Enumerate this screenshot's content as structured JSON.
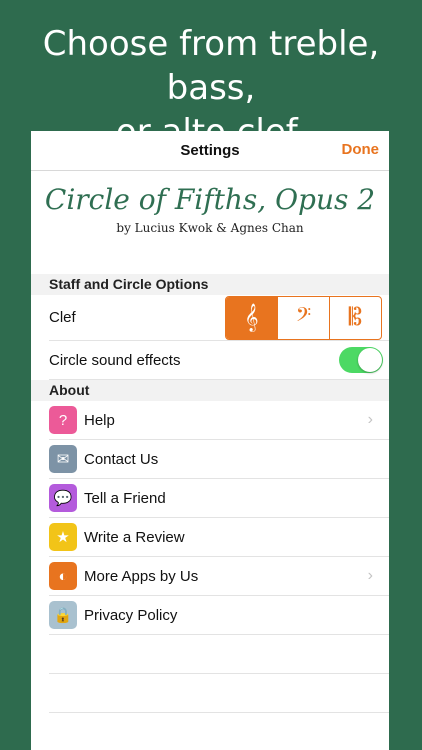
{
  "promo": {
    "line1": "Choose from treble, bass,",
    "line2": "or alto clef."
  },
  "nav": {
    "title": "Settings",
    "done": "Done"
  },
  "app": {
    "title": "Circle of Fifths, Opus 2",
    "byline": "by Lucius Kwok & Agnes Chan"
  },
  "staff_section": {
    "header": "Staff and Circle Options",
    "clef_label": "Clef",
    "clef_options": [
      {
        "icon": "treble-clef-icon",
        "glyph": "𝄞",
        "selected": true
      },
      {
        "icon": "bass-clef-icon",
        "glyph": "𝄢",
        "selected": false
      },
      {
        "icon": "alto-clef-icon",
        "glyph": "𝄡",
        "selected": false
      }
    ],
    "sound_label": "Circle sound effects",
    "sound_on": true
  },
  "about_section": {
    "header": "About",
    "items": [
      {
        "label": "Help",
        "icon": "help-icon",
        "glyph": "?",
        "color": "#ec5a98",
        "chevron": true
      },
      {
        "label": "Contact Us",
        "icon": "envelope-icon",
        "glyph": "✉",
        "color": "#7d93a6",
        "chevron": false
      },
      {
        "label": "Tell a Friend",
        "icon": "chat-bubble-icon",
        "glyph": "💬",
        "color": "#b45bdc",
        "chevron": false
      },
      {
        "label": "Write a Review",
        "icon": "star-icon",
        "glyph": "★",
        "color": "#f2c418",
        "chevron": false
      },
      {
        "label": "More Apps by Us",
        "icon": "compass-icon",
        "glyph": "◐",
        "color": "#e8741f",
        "chevron": true
      },
      {
        "label": "Privacy Policy",
        "icon": "lock-icon",
        "glyph": "🔒",
        "color": "#a9c1cf",
        "chevron": false
      }
    ]
  },
  "colors": {
    "background": "#2e6b4e",
    "accent": "#e8741f",
    "toggle_on": "#4cd964",
    "title_green": "#2f6f52"
  }
}
